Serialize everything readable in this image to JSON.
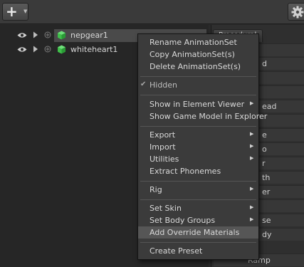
{
  "toolbar": {
    "add_symbol": "+",
    "dropdown_symbol": "▼"
  },
  "tree": {
    "items": [
      {
        "label": "nepgear1",
        "selected": true
      },
      {
        "label": "whiteheart1",
        "selected": false
      }
    ]
  },
  "right_panel": {
    "tab_label": "Procedural",
    "rows": [
      "ult",
      "d",
      "",
      "",
      "ead",
      "",
      "e",
      "o",
      "r",
      "th",
      "er",
      "",
      "se",
      "dy",
      "Ramp"
    ]
  },
  "context_menu": {
    "items": [
      {
        "label": "Rename AnimationSet"
      },
      {
        "label": "Copy AnimationSet(s)"
      },
      {
        "label": "Delete AnimationSet(s)"
      },
      {
        "label": "Hidden",
        "checked": true
      },
      {
        "label": "Show in Element Viewer",
        "submenu": true
      },
      {
        "label": "Show Game Model in Explorer"
      },
      {
        "label": "Export",
        "submenu": true
      },
      {
        "label": "Import",
        "submenu": true
      },
      {
        "label": "Utilities",
        "submenu": true
      },
      {
        "label": "Extract Phonemes"
      },
      {
        "label": "Rig",
        "submenu": true
      },
      {
        "label": "Set Skin",
        "submenu": true
      },
      {
        "label": "Set Body Groups",
        "submenu": true
      },
      {
        "label": "Add Override Materials",
        "highlighted": true
      },
      {
        "label": "Create Preset"
      }
    ],
    "check_symbol": "✔",
    "submenu_symbol": "▶"
  },
  "colors": {
    "cube_green": "#3fbf4a",
    "menu_bg": "#3b3b3b",
    "highlight": "#565656"
  }
}
